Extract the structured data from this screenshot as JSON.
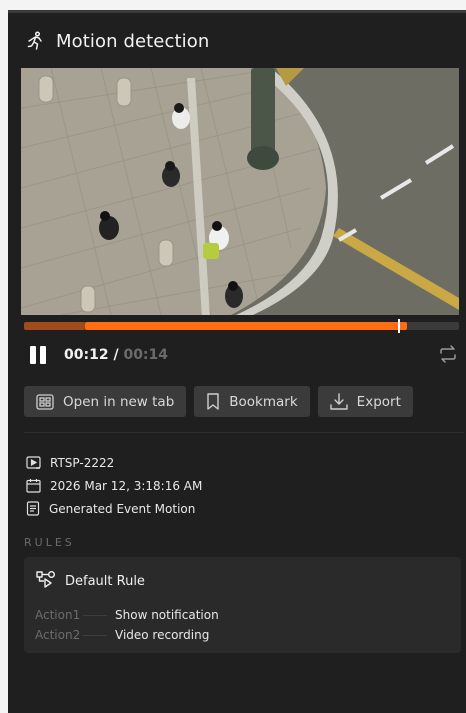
{
  "header": {
    "title": "Motion detection",
    "icon": "motion-running-icon"
  },
  "player": {
    "current_time": "00:12",
    "separator": " / ",
    "total_time": "00:14",
    "buffered_fraction": 0.14,
    "played_start_fraction": 0.14,
    "played_end_fraction": 0.88,
    "handle_fraction": 0.86,
    "colors": {
      "played": "#ff6d13",
      "buffered": "#9f4b1c",
      "track": "#3b3b3b"
    }
  },
  "actions": {
    "open_tab": "Open in new tab",
    "bookmark": "Bookmark",
    "export": "Export"
  },
  "meta": {
    "source": "RTSP-2222",
    "datetime": "2026 Mar 12, 3:18:16 AM",
    "event": "Generated Event Motion"
  },
  "rules": {
    "section_label": "RULES",
    "title": "Default Rule",
    "items": [
      {
        "name": "Action1",
        "value": "Show notification"
      },
      {
        "name": "Action2",
        "value": "Video recording"
      }
    ]
  }
}
